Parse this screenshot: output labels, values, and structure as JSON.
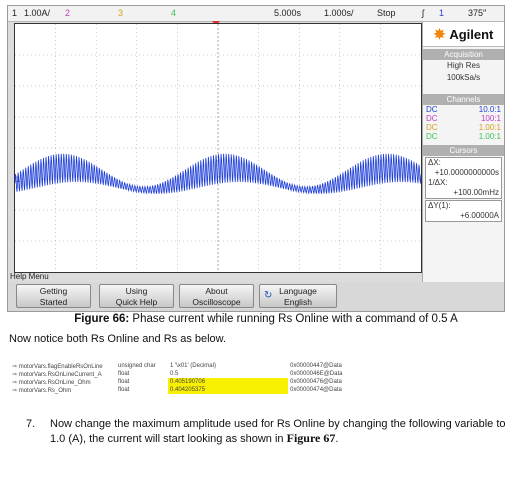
{
  "scope": {
    "status": {
      "ch1_num": "1",
      "ch1_scale": "1.00A/",
      "ch2_num": "2",
      "ch3_num": "3",
      "ch4_num": "4",
      "time_pos": "5.000s",
      "time_scale": "1.000s/",
      "run_state": "Stop",
      "trig_slope": "ʃ",
      "trig_ch": "1",
      "trig_level": "375″"
    },
    "colors": {
      "trace": "#1f3fd8",
      "ch2": "#c040c0",
      "ch3": "#d8a020",
      "ch4": "#40c060",
      "grid": "#9a9a9a"
    },
    "trace_summary": {
      "offset_divisions": 1.0,
      "envelope_amplitude_divisions": 0.35,
      "oscillation_divisions": 0.5,
      "slow_cycles": 2.5
    },
    "side": {
      "brand": "Agilent",
      "acq_head": "Acquisition",
      "acq_mode": "High Res",
      "acq_rate": "100kSa/s",
      "channels_head": "Channels",
      "channels": [
        {
          "coupling": "DC",
          "probe": "10.0:1",
          "color": "#1f3fd8"
        },
        {
          "coupling": "DC",
          "probe": "100:1",
          "color": "#c040c0"
        },
        {
          "coupling": "DC",
          "probe": "1.00:1",
          "color": "#d8a020"
        },
        {
          "coupling": "DC",
          "probe": "1.00:1",
          "color": "#40c060"
        }
      ],
      "cursors_head": "Cursors",
      "dx_label": "ΔX:",
      "dx_value": "+10.0000000000s",
      "inv_dx_label": "1/ΔX:",
      "inv_dx_value": "+100.00mHz",
      "dy_label": "ΔY(1):",
      "dy_value": "+6.00000A"
    },
    "help_menu": "Help Menu",
    "softkeys": [
      {
        "line1": "Getting",
        "line2": "Started"
      },
      {
        "line1": "Using",
        "line2": "Quick Help"
      },
      {
        "line1": "About",
        "line2": "Oscilloscope"
      },
      {
        "line1": "Language",
        "line2": "English",
        "icon": "swap-arrows-icon"
      }
    ]
  },
  "caption": {
    "label": "Figure 66:",
    "text": " Phase current while running Rs Online with a command of 0.5 A"
  },
  "body_text": "Now notice both Rs Online and Rs as below.",
  "variables": [
    {
      "name": "motorVars.flagEnableRsOnLine",
      "type": "unsigned char",
      "value": "1 '\\x01' (Decimal)",
      "address": "0x00000447@Data",
      "highlight": false
    },
    {
      "name": "motorVars.RsOnLineCurrent_A",
      "type": "float",
      "value": "0.5",
      "address": "0x0000046E@Data",
      "highlight": false
    },
    {
      "name": "motorVars.RsOnLine_Ohm",
      "type": "float",
      "value": "0.405190706",
      "address": "0x00000476@Data",
      "highlight": true
    },
    {
      "name": "motorVars.Rs_Ohm",
      "type": "float",
      "value": "0.404205375",
      "address": "0x00000474@Data",
      "highlight": true
    }
  ],
  "step": {
    "number": "7.",
    "text_before": "Now change the maximum amplitude used for Rs Online by changing the following variable to 1.0 (A), the current will start looking as shown in ",
    "figure_ref": "Figure 67",
    "text_after": "."
  }
}
